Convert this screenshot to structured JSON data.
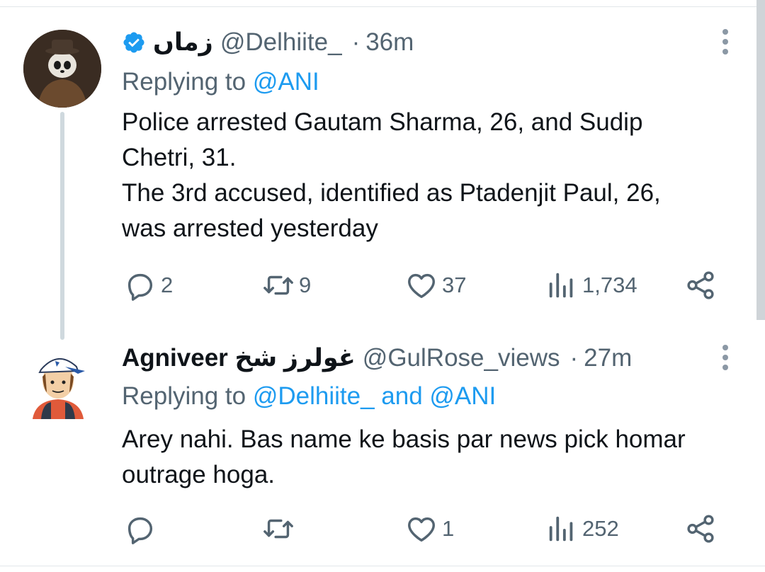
{
  "tweets": [
    {
      "display_name": "زماں",
      "handle": "@Delhiite_",
      "separator": "·",
      "time": "36m",
      "replying_prefix": "Replying to",
      "replying_to": "@ANI",
      "body_lines": [
        "Police arrested Gautam Sharma, 26, and Sudip",
        "Chetri, 31.",
        "The 3rd accused, identified as Ptadenjit Paul, 26,",
        "was arrested yesterday"
      ],
      "replies": "2",
      "reposts": "9",
      "likes": "37",
      "views": "1,734",
      "verified": true,
      "avatar_icon": "panda-detective-avatar"
    },
    {
      "display_name": "Agniveer غولرز شخ",
      "handle": "@GulRose_views",
      "separator": "·",
      "time": "27m",
      "replying_prefix": "Replying to",
      "replying_to": "@Delhiite_ and @ANI",
      "body_lines": [
        "Arey nahi. Bas name ke basis par news pick homar",
        "outrage hoga."
      ],
      "replies": "",
      "reposts": "",
      "likes": "1",
      "views": "252",
      "verified": false,
      "avatar_icon": "cartoon-boy-cap-avatar"
    }
  ],
  "colors": {
    "accent": "#1d9bf0",
    "secondary_text": "#536471",
    "primary_text": "#0f1419",
    "thread_line": "#cfd9de"
  }
}
